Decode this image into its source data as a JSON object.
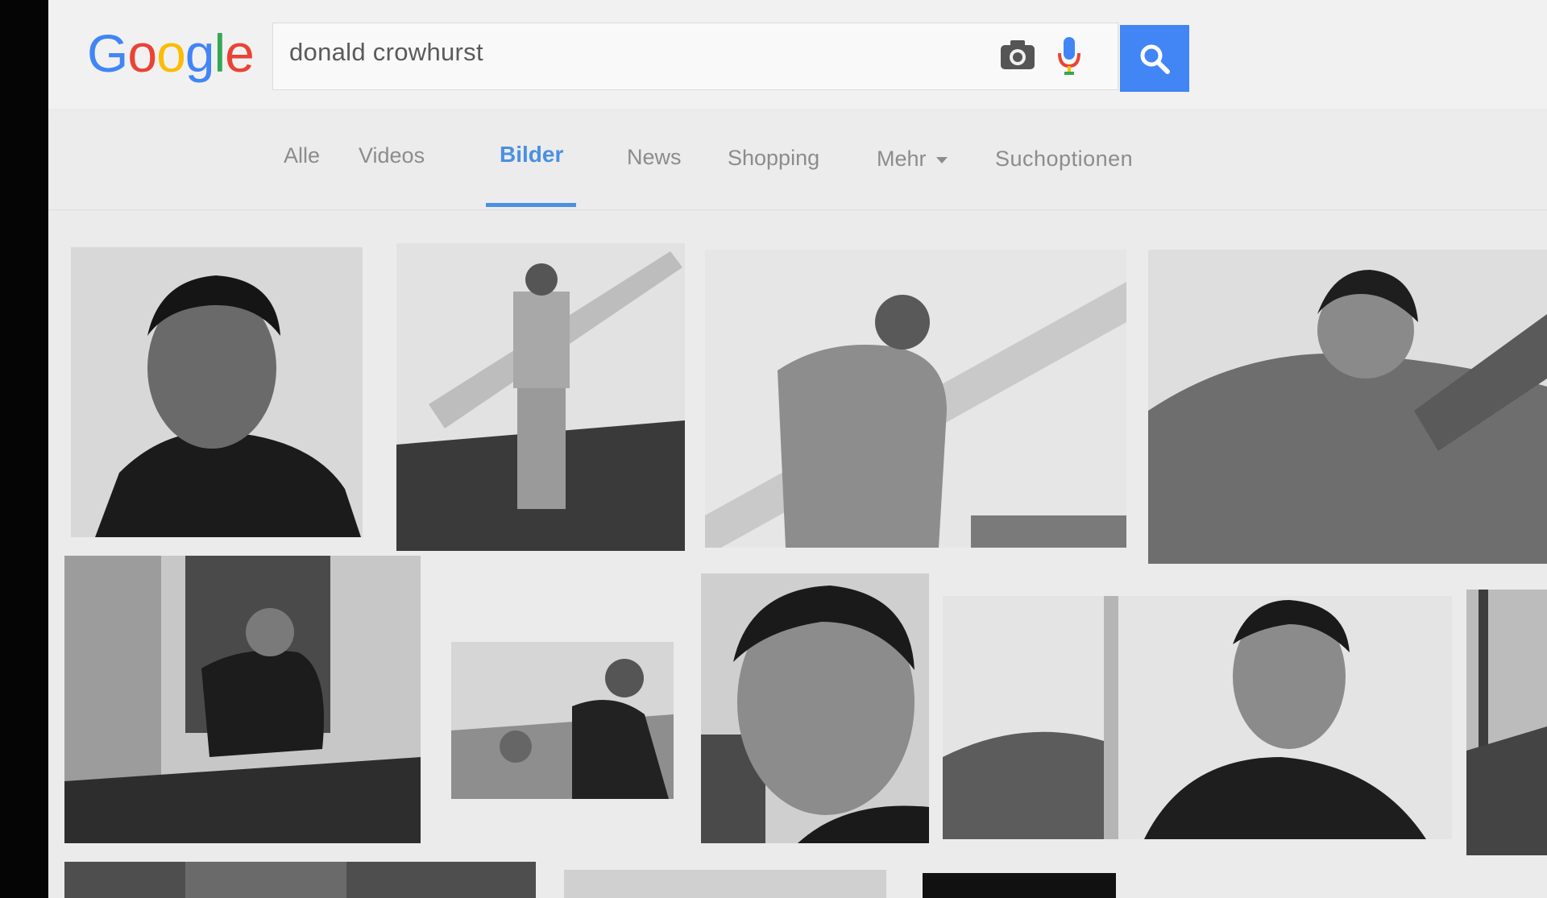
{
  "logo": {
    "letters": [
      "G",
      "o",
      "o",
      "g",
      "l",
      "e"
    ],
    "colors": [
      "#4285f4",
      "#ea4335",
      "#fbbc05",
      "#4285f4",
      "#34a853",
      "#ea4335"
    ]
  },
  "search": {
    "query": "donald crowhurst"
  },
  "icons": {
    "camera": "camera-icon",
    "mic": "microphone-icon",
    "search": "search-icon",
    "dropdown": "caret-down-icon"
  },
  "accent": "#4285f4",
  "tabs": [
    {
      "label": "Alle"
    },
    {
      "label": "Videos"
    },
    {
      "label": "Bilder",
      "active": true
    },
    {
      "label": "News"
    },
    {
      "label": "Shopping"
    },
    {
      "label": "Mehr"
    },
    {
      "label": "Suchoptionen"
    }
  ]
}
